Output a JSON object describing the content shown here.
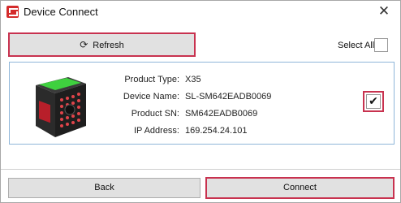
{
  "window": {
    "title": "Device Connect",
    "close_glyph": "✕"
  },
  "toolbar": {
    "refresh_label": "Refresh",
    "refresh_icon": "refresh-icon",
    "select_all_label": "Select All",
    "select_all_checked": false
  },
  "device": {
    "fields": [
      {
        "label": "Product Type:",
        "value": "X35"
      },
      {
        "label": "Device Name:",
        "value": "SL-SM642EADB0069"
      },
      {
        "label": "Product SN:",
        "value": "SM642EADB0069"
      },
      {
        "label": "IP Address:",
        "value": "169.254.24.101"
      }
    ],
    "checked": true,
    "check_glyph": "✔"
  },
  "footer": {
    "back_label": "Back",
    "connect_label": "Connect"
  },
  "colors": {
    "highlight": "#c8324f",
    "selection_border": "#8fb6d9",
    "brand": "#d42b2b",
    "device_led": "#3fd13f"
  }
}
